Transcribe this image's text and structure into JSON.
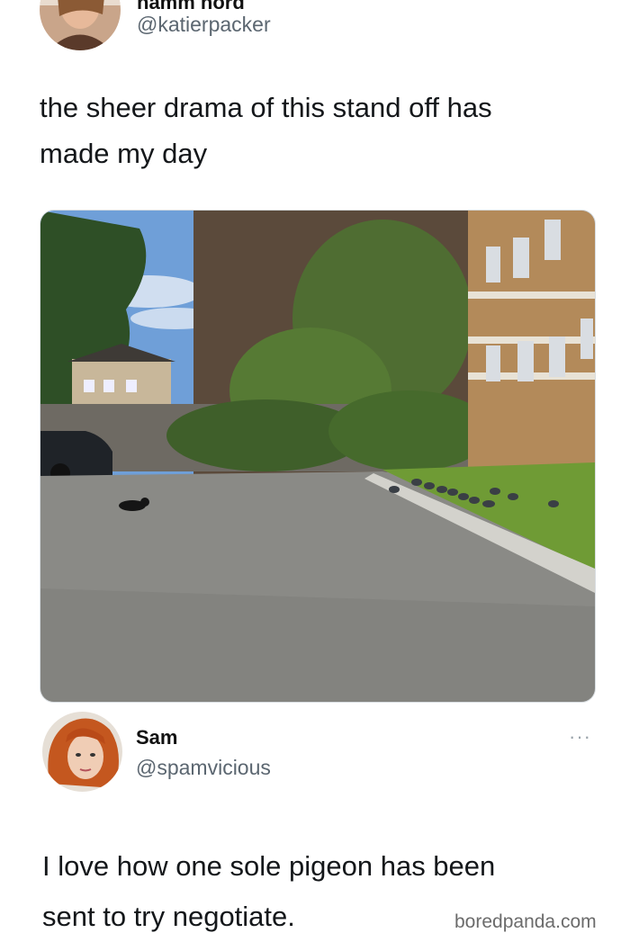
{
  "tweet1": {
    "display_name_partial": "namm nord",
    "handle": "@katierpacker",
    "text_line1": "the sheer drama of this stand off has",
    "text_line2": "made my day"
  },
  "tweet2": {
    "display_name": "Sam",
    "handle": "@spamvicious",
    "more_label": "···",
    "text_line1": "I love how one sole pigeon has been",
    "text_line2": "sent to try negotiate."
  },
  "watermark": "boredpanda.com",
  "colors": {
    "text": "#14171a",
    "handle": "#5b6670",
    "sky": "#6f9fd8",
    "asphalt": "#8a8a86",
    "grass": "#6f9b35",
    "brick": "#b38a5a"
  }
}
